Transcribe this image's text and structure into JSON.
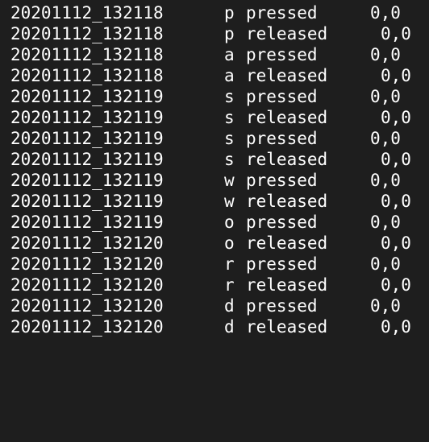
{
  "terminal": {
    "rows": [
      {
        "timestamp": "20201112_132118",
        "key": "p",
        "action": "pressed",
        "coords": "0,0"
      },
      {
        "timestamp": "20201112_132118",
        "key": "p",
        "action": "released",
        "coords": "0,0"
      },
      {
        "timestamp": "20201112_132118",
        "key": "a",
        "action": "pressed",
        "coords": "0,0"
      },
      {
        "timestamp": "20201112_132118",
        "key": "a",
        "action": "released",
        "coords": "0,0"
      },
      {
        "timestamp": "20201112_132119",
        "key": "s",
        "action": "pressed",
        "coords": "0,0"
      },
      {
        "timestamp": "20201112_132119",
        "key": "s",
        "action": "released",
        "coords": "0,0"
      },
      {
        "timestamp": "20201112_132119",
        "key": "s",
        "action": "pressed",
        "coords": "0,0"
      },
      {
        "timestamp": "20201112_132119",
        "key": "s",
        "action": "released",
        "coords": "0,0"
      },
      {
        "timestamp": "20201112_132119",
        "key": "w",
        "action": "pressed",
        "coords": "0,0"
      },
      {
        "timestamp": "20201112_132119",
        "key": "w",
        "action": "released",
        "coords": "0,0"
      },
      {
        "timestamp": "20201112_132119",
        "key": "o",
        "action": "pressed",
        "coords": "0,0"
      },
      {
        "timestamp": "20201112_132120",
        "key": "o",
        "action": "released",
        "coords": "0,0"
      },
      {
        "timestamp": "20201112_132120",
        "key": "r",
        "action": "pressed",
        "coords": "0,0"
      },
      {
        "timestamp": "20201112_132120",
        "key": "r",
        "action": "released",
        "coords": "0,0"
      },
      {
        "timestamp": "20201112_132120",
        "key": "d",
        "action": "pressed",
        "coords": "0,0"
      },
      {
        "timestamp": "20201112_132120",
        "key": "d",
        "action": "released",
        "coords": "0,0"
      }
    ]
  }
}
